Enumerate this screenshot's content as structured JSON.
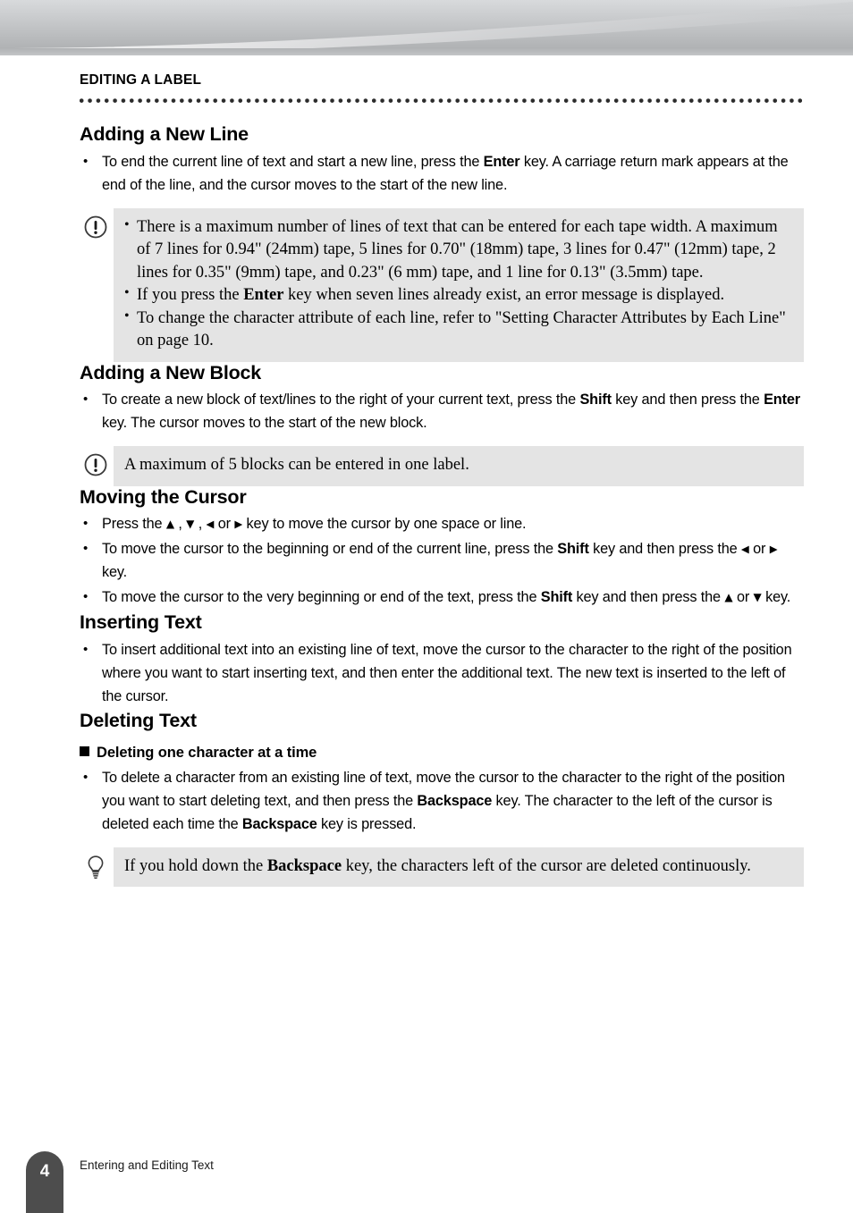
{
  "header": {
    "chapter_title": "EDITING A LABEL"
  },
  "sections": [
    {
      "id": "adding-a-new-line",
      "heading": "Adding a New Line",
      "bullets": [
        {
          "parts": [
            {
              "t": "To end the current line of text and start a new line, press the "
            },
            {
              "t": "Enter",
              "b": true
            },
            {
              "t": " key. A carriage return mark appears at the end of the line, and the cursor moves to the start of the new line."
            }
          ]
        }
      ],
      "note": {
        "icon": "warning-icon",
        "items": [
          {
            "parts": [
              {
                "t": "There is a maximum number of lines of text that can be entered for each tape width. A maximum of 7 lines for 0.94\" (24mm) tape, 5 lines for 0.70\" (18mm) tape, 3 lines for 0.47\" (12mm) tape, 2 lines for 0.35\" (9mm) tape, and 0.23\" (6 mm) tape, and 1 line for 0.13\" (3.5mm) tape."
              }
            ]
          },
          {
            "parts": [
              {
                "t": "If you press the "
              },
              {
                "t": "Enter",
                "b": true
              },
              {
                "t": " key when seven lines already exist, an error message is displayed."
              }
            ]
          },
          {
            "parts": [
              {
                "t": "To change the character attribute of each line, refer to \"Setting Character Attributes by Each Line\" on page 10."
              }
            ]
          }
        ]
      }
    },
    {
      "id": "adding-a-new-block",
      "heading": "Adding a New Block",
      "bullets": [
        {
          "parts": [
            {
              "t": "To create a new block of text/lines to the right of your current text, press the "
            },
            {
              "t": "Shift",
              "b": true
            },
            {
              "t": " key and then press the "
            },
            {
              "t": "Enter",
              "b": true
            },
            {
              "t": " key. The cursor moves to the start of the new block."
            }
          ]
        }
      ],
      "note": {
        "icon": "warning-icon",
        "items": [
          {
            "parts": [
              {
                "t": "A maximum of 5 blocks can be entered in one label."
              }
            ]
          }
        ]
      }
    },
    {
      "id": "moving-the-cursor",
      "heading": "Moving the Cursor",
      "bullets": [
        {
          "parts": [
            {
              "t": "Press the "
            },
            {
              "t": "▲",
              "arrow": "up"
            },
            {
              "t": " , "
            },
            {
              "t": "▼",
              "arrow": "down"
            },
            {
              "t": " , "
            },
            {
              "t": "◀",
              "arrow": "left"
            },
            {
              "t": " or "
            },
            {
              "t": "▶",
              "arrow": "right"
            },
            {
              "t": " key to move the cursor by one space or line."
            }
          ]
        },
        {
          "parts": [
            {
              "t": "To move the cursor to the beginning or end of the current line, press the "
            },
            {
              "t": "Shift",
              "b": true
            },
            {
              "t": " key and then press the "
            },
            {
              "t": "◀",
              "arrow": "left"
            },
            {
              "t": " or "
            },
            {
              "t": "▶",
              "arrow": "right"
            },
            {
              "t": " key."
            }
          ]
        },
        {
          "parts": [
            {
              "t": "To move the cursor to the very beginning or end of the text, press the "
            },
            {
              "t": "Shift",
              "b": true
            },
            {
              "t": " key and then press the "
            },
            {
              "t": "▲",
              "arrow": "up"
            },
            {
              "t": " or "
            },
            {
              "t": "▼",
              "arrow": "down"
            },
            {
              "t": " key."
            }
          ]
        }
      ]
    },
    {
      "id": "inserting-text",
      "heading": "Inserting Text",
      "bullets": [
        {
          "parts": [
            {
              "t": "To insert additional text into an existing line of text, move the cursor to the character to the right of the position where you want to start inserting text, and then enter the additional text. The new text is inserted to the left of the cursor."
            }
          ]
        }
      ]
    },
    {
      "id": "deleting-text",
      "heading": "Deleting Text",
      "subsection": {
        "heading": "Deleting one character at a time",
        "bullets": [
          {
            "parts": [
              {
                "t": "To delete a character from an existing line of text, move the cursor to the character to the right of the position you want to start deleting text, and then press the "
              },
              {
                "t": "Backspace",
                "b": true
              },
              {
                "t": " key. The character to the left of the cursor is deleted each time the "
              },
              {
                "t": "Backspace",
                "b": true
              },
              {
                "t": " key is pressed."
              }
            ]
          }
        ],
        "tip": {
          "icon": "lightbulb-icon",
          "items": [
            {
              "parts": [
                {
                  "t": "If you hold down the "
                },
                {
                  "t": "Backspace",
                  "b": true
                },
                {
                  "t": " key, the characters left of the cursor are deleted continuously."
                }
              ]
            }
          ]
        }
      }
    }
  ],
  "footer": {
    "page_number": "4",
    "running_title": "Entering and Editing Text"
  },
  "colors": {
    "note_background": "#e4e4e4",
    "page_tab": "#4d4d4d",
    "banner_top": "#cfd1d3",
    "banner_bottom": "#a7a9ab",
    "text": "#000000"
  }
}
